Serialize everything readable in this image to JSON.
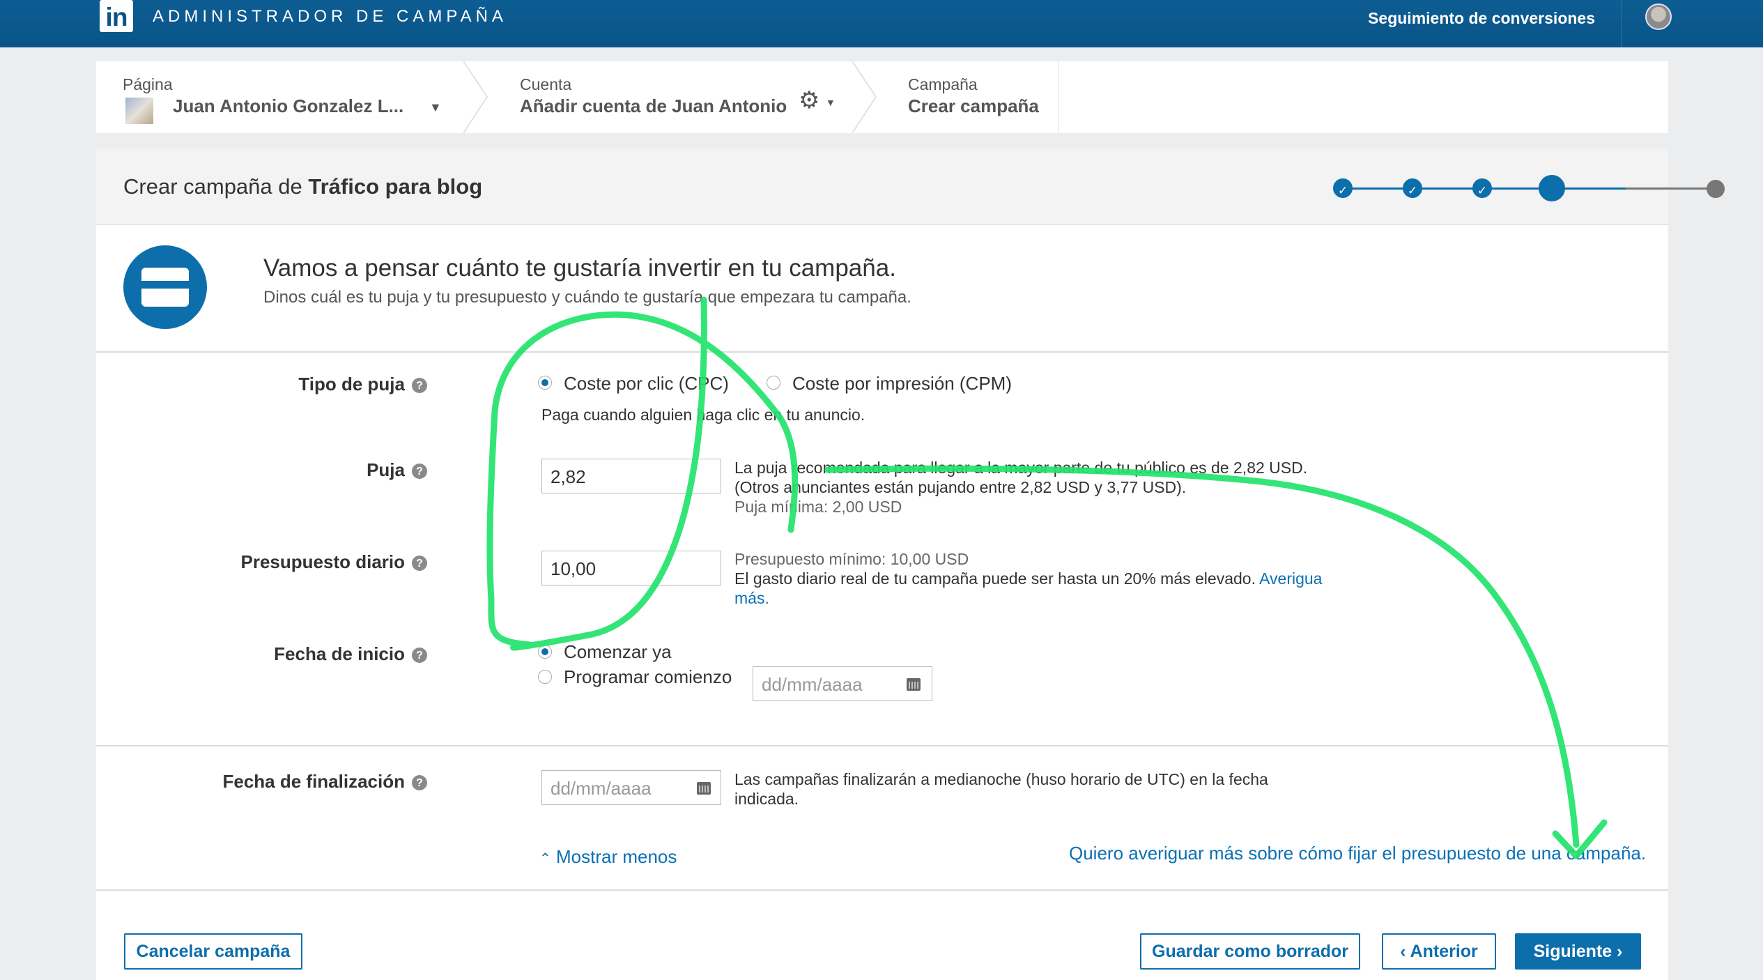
{
  "app": {
    "logo": "in",
    "title": "ADMINISTRADOR DE CAMPAÑA"
  },
  "topbar": {
    "conversion_link": "Seguimiento de conversiones",
    "avatar_icon": "user-avatar"
  },
  "breadcrumb": {
    "page": {
      "label": "Página",
      "value": "Juan Antonio Gonzalez L..."
    },
    "account": {
      "label": "Cuenta",
      "value": "Añadir cuenta de Juan Antonio"
    },
    "campaign": {
      "label": "Campaña",
      "value": "Crear campaña"
    }
  },
  "header": {
    "title_prefix": "Crear campaña de ",
    "title_bold": "Tráfico para blog",
    "steps": [
      {
        "state": "done",
        "glyph": "✓"
      },
      {
        "state": "done",
        "glyph": "✓"
      },
      {
        "state": "done",
        "glyph": "✓"
      },
      {
        "state": "current",
        "glyph": ""
      },
      {
        "state": "todo",
        "glyph": ""
      }
    ]
  },
  "intro": {
    "icon": "credit-card-icon",
    "title": "Vamos a pensar cuánto te gustaría invertir en tu campaña.",
    "subtitle": "Dinos cuál es tu puja y tu presupuesto y cuándo te gustaría que empezara tu campaña."
  },
  "form": {
    "bid_type": {
      "label": "Tipo de puja",
      "option_cpc": "Coste por clic (CPC)",
      "option_cpm": "Coste por impresión (CPM)",
      "selected": "cpc",
      "description": "Paga cuando alguien haga clic en tu anuncio."
    },
    "bid": {
      "label": "Puja",
      "value": "2,82",
      "note_1": "La puja recomendada para llegar a la mayor parte de tu público es de 2,82 USD.",
      "note_2": "(Otros anunciantes están pujando entre 2,82 USD y 3,77 USD).",
      "note_3": "Puja mínima: 2,00 USD"
    },
    "daily_budget": {
      "label": "Presupuesto diario",
      "value": "10,00",
      "note_1": "Presupuesto mínimo: 10,00 USD",
      "note_2": "El gasto diario real de tu campaña puede ser hasta un 20% más elevado.",
      "link_part1": "Averigua",
      "link_part2": "más."
    },
    "start_date": {
      "label": "Fecha de inicio",
      "option_now": "Comenzar ya",
      "option_schedule": "Programar comienzo",
      "selected": "now",
      "placeholder": "dd/mm/aaaa"
    },
    "end_date": {
      "label": "Fecha de finalización",
      "placeholder": "dd/mm/aaaa",
      "note_1": "Las campañas finalizarán a medianoche (huso horario de UTC) en la fecha",
      "note_2": "indicada."
    },
    "show_less": "Mostrar menos",
    "budget_help_link": "Quiero averiguar más sobre cómo fijar el presupuesto de una campaña."
  },
  "footer": {
    "cancel": "Cancelar campaña",
    "save_draft": "Guardar como borrador",
    "previous": "‹ Anterior",
    "next": "Siguiente ›"
  },
  "colors": {
    "brand": "#0d6eac",
    "topbar": "#0a5487",
    "annotation": "#22e36a"
  }
}
